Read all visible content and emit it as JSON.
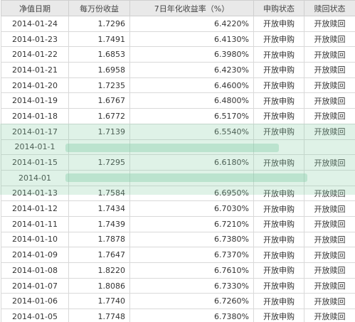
{
  "table": {
    "headers": [
      "净值日期",
      "每万份收益",
      "7日年化收益率（%）",
      "申购状态",
      "赎回状态"
    ],
    "rows": [
      {
        "date": "2014-01-24",
        "unit": "1.7296",
        "rate": "6.4220%",
        "buy": "开放申购",
        "redeem": "开放赎回"
      },
      {
        "date": "2014-01-23",
        "unit": "1.7491",
        "rate": "6.4130%",
        "buy": "开放申购",
        "redeem": "开放赎回"
      },
      {
        "date": "2014-01-22",
        "unit": "1.6853",
        "rate": "6.3980%",
        "buy": "开放申购",
        "redeem": "开放赎回"
      },
      {
        "date": "2014-01-21",
        "unit": "1.6958",
        "rate": "6.4230%",
        "buy": "开放申购",
        "redeem": "开放赎回"
      },
      {
        "date": "2014-01-20",
        "unit": "1.7235",
        "rate": "6.4600%",
        "buy": "开放申购",
        "redeem": "开放赎回"
      },
      {
        "date": "2014-01-19",
        "unit": "1.6767",
        "rate": "6.4800%",
        "buy": "开放申购",
        "redeem": "开放赎回"
      },
      {
        "date": "2014-01-18",
        "unit": "1.6772",
        "rate": "6.5170%",
        "buy": "开放申购",
        "redeem": "开放赎回"
      },
      {
        "date": "2014-01-17",
        "unit": "1.7139",
        "rate": "6.5540%",
        "buy": "开放申购",
        "redeem": "开放赎回"
      },
      {
        "date": "2014-01-1",
        "unit": "",
        "rate": "",
        "buy": "",
        "redeem": ""
      },
      {
        "date": "2014-01-15",
        "unit": "1.7295",
        "rate": "6.6180%",
        "buy": "开放申购",
        "redeem": "开放赎回"
      },
      {
        "date": "2014-01",
        "unit": "",
        "rate": "",
        "buy": "",
        "redeem": ""
      },
      {
        "date": "2014-01-13",
        "unit": "1.7584",
        "rate": "6.6950%",
        "buy": "开放申购",
        "redeem": "开放赎回"
      },
      {
        "date": "2014-01-12",
        "unit": "1.7434",
        "rate": "6.7030%",
        "buy": "开放申购",
        "redeem": "开放赎回"
      },
      {
        "date": "2014-01-11",
        "unit": "1.7439",
        "rate": "6.7210%",
        "buy": "开放申购",
        "redeem": "开放赎回"
      },
      {
        "date": "2014-01-10",
        "unit": "1.7878",
        "rate": "6.7380%",
        "buy": "开放申购",
        "redeem": "开放赎回"
      },
      {
        "date": "2014-01-09",
        "unit": "1.7647",
        "rate": "6.7370%",
        "buy": "开放申购",
        "redeem": "开放赎回"
      },
      {
        "date": "2014-01-08",
        "unit": "1.8220",
        "rate": "6.7610%",
        "buy": "开放申购",
        "redeem": "开放赎回"
      },
      {
        "date": "2014-01-07",
        "unit": "1.8086",
        "rate": "6.7330%",
        "buy": "开放申购",
        "redeem": "开放赎回"
      },
      {
        "date": "2014-01-06",
        "unit": "1.7740",
        "rate": "6.7260%",
        "buy": "开放申购",
        "redeem": "开放赎回"
      },
      {
        "date": "2014-01-05",
        "unit": "1.7748",
        "rate": "6.7380%",
        "buy": "开放申购",
        "redeem": "开放赎回"
      }
    ]
  },
  "colors": {
    "header_bg": "#e9e9e9",
    "grid": "#d9d9d9",
    "text": "#333333",
    "watermark": "#8cd2aa"
  }
}
